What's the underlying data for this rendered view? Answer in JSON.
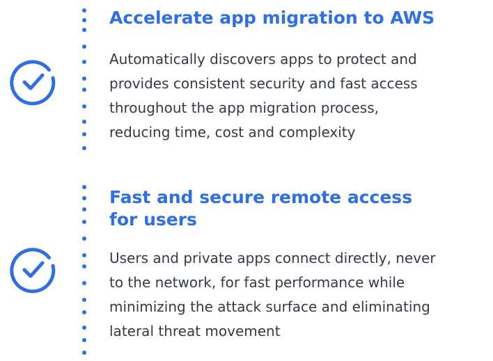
{
  "colors": {
    "accent": "#2f6fe6",
    "body_text": "#333a44"
  },
  "features": [
    {
      "icon": "check-circle-icon",
      "title": "Accelerate app migration to AWS",
      "description_lines": [
        "Automatically discovers apps to protect and",
        "provides consistent security and fast access",
        "throughout the app migration process,",
        "reducing time, cost and complexity"
      ]
    },
    {
      "icon": "check-circle-icon",
      "title_lines": [
        "Fast and secure remote access",
        "for users"
      ],
      "description_lines": [
        "Users and private apps connect directly, never",
        "to the network, for fast performance while",
        "minimizing the attack surface and eliminating",
        "lateral threat movement"
      ]
    }
  ]
}
